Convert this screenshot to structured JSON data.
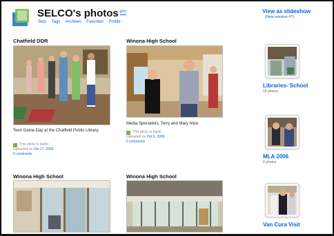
{
  "header": {
    "title": "SELCO's photos",
    "badge": "pro",
    "nav": [
      "Sets",
      "Tags",
      "Archives",
      "Favorites",
      "Profile"
    ],
    "slideshow_label": "View as slideshow",
    "slideshow_sub": "(New window #?)"
  },
  "photos": [
    {
      "title": "Chatfield DDR",
      "caption": "Teen Game Day at the Chatfield Public Library.",
      "privacy": "This photo is public",
      "uploaded_prefix": "Uploaded on",
      "uploaded_date": "Oct 17, 2006",
      "comments": "0 comments"
    },
    {
      "title": "Winona High School",
      "caption": "Media Specialists, Terry and Mary Alice",
      "privacy": "This photo is public",
      "uploaded_prefix": "Uploaded on",
      "uploaded_date": "Oct 6, 2006",
      "comments": "0 comments"
    },
    {
      "title": "Winona High School"
    },
    {
      "title": "Winona High School"
    }
  ],
  "sets": [
    {
      "title": "Libraries- School",
      "count": "18 photos"
    },
    {
      "title": "MLA 2006",
      "count": "8 photos"
    },
    {
      "title": "Van Cura Visit",
      "count": ""
    }
  ],
  "colors": {
    "link": "#0063dc",
    "public_icon": "#7bb04a"
  }
}
